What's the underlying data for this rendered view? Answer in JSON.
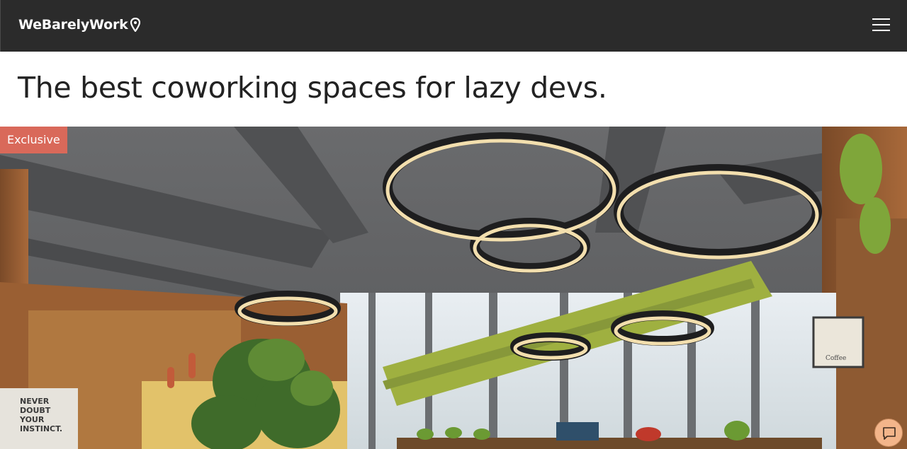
{
  "navbar": {
    "brand": "WeBarelyWork",
    "location_icon": "map-pin-icon",
    "menu_icon": "hamburger-menu-icon",
    "background": "#2b2b2b"
  },
  "main": {
    "headline": "The best coworking spaces for lazy devs."
  },
  "hero": {
    "badge": "Exclusive",
    "badge_color": "#d9695a",
    "wall_text": [
      "NEVER",
      "DOUBT",
      "YOUR",
      "INSTINCT."
    ],
    "sign_text": [
      "Coffee"
    ]
  },
  "chat": {
    "icon": "chat-bubble-icon"
  }
}
